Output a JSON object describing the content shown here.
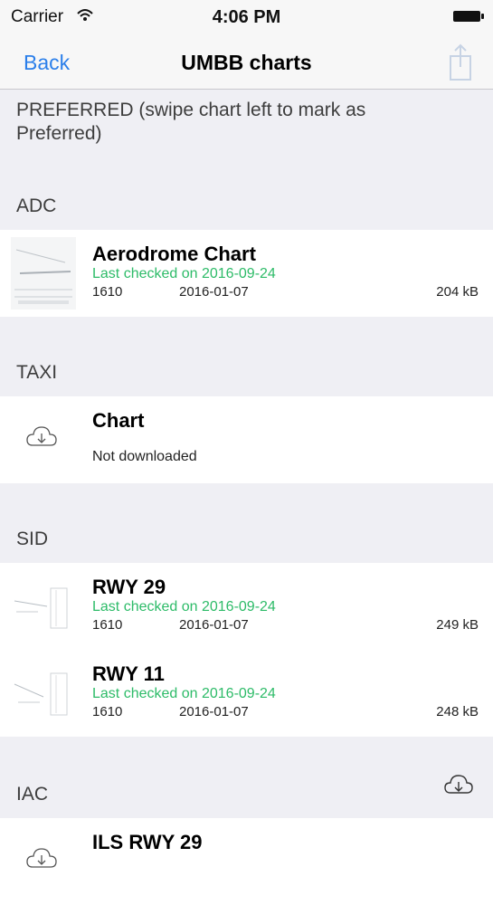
{
  "status_bar": {
    "carrier": "Carrier",
    "time": "4:06 PM"
  },
  "nav": {
    "back_label": "Back",
    "title": "UMBB charts"
  },
  "preferred_header": "PREFERRED (swipe chart left to mark as Preferred)",
  "sections": [
    {
      "name": "ADC",
      "items": [
        {
          "title": "Aerodrome Chart",
          "status": "Last checked on 2016-09-24",
          "cycle": "1610",
          "date": "2016-01-07",
          "size": "204 kB"
        }
      ]
    },
    {
      "name": "TAXI",
      "items": [
        {
          "title": "Chart",
          "state": "Not downloaded"
        }
      ]
    },
    {
      "name": "SID",
      "items": [
        {
          "title": "RWY 29",
          "status": "Last checked on 2016-09-24",
          "cycle": "1610",
          "date": "2016-01-07",
          "size": "249 kB"
        },
        {
          "title": "RWY 11",
          "status": "Last checked on 2016-09-24",
          "cycle": "1610",
          "date": "2016-01-07",
          "size": "248 kB"
        }
      ]
    },
    {
      "name": "IAC",
      "items": [
        {
          "title": "ILS RWY 29"
        }
      ]
    }
  ],
  "colors": {
    "accent": "#2b7fea",
    "status_green": "#2dbb68",
    "section_bg": "#efeff4"
  }
}
